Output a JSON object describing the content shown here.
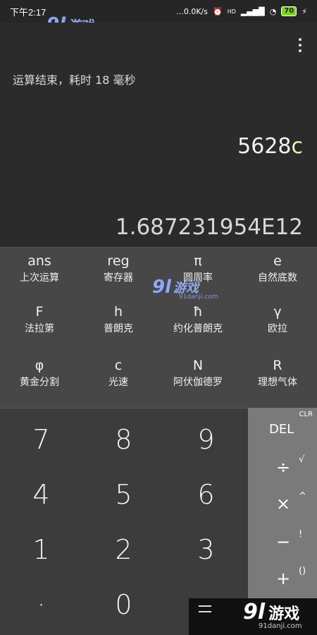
{
  "status_bar": {
    "time": "下午2:17",
    "net_speed": "...0.0K/s",
    "alarm": "⏰",
    "hd": "HD",
    "signal": "▂▄▆█",
    "wifi": "◔",
    "battery": "70",
    "charging": "⚡"
  },
  "watermark": {
    "logo": "9l",
    "text": "游戏",
    "sub": "91danji.com"
  },
  "display": {
    "status_message": "运算结束，耗时 18 毫秒",
    "expression_main": "5628",
    "expression_const": "c",
    "result": "1.687231954E12"
  },
  "constants": [
    {
      "symbol": "ans",
      "label": "上次运算"
    },
    {
      "symbol": "reg",
      "label": "寄存器"
    },
    {
      "symbol": "π",
      "label": "圆周率"
    },
    {
      "symbol": "e",
      "label": "自然底数"
    },
    {
      "symbol": "F",
      "label": "法拉第"
    },
    {
      "symbol": "h",
      "label": "普朗克"
    },
    {
      "symbol": "ħ",
      "label": "约化普朗克"
    },
    {
      "symbol": "γ",
      "label": "欧拉"
    },
    {
      "symbol": "φ",
      "label": "黄金分割"
    },
    {
      "symbol": "c",
      "label": "光速"
    },
    {
      "symbol": "N",
      "label": "阿伏伽德罗"
    },
    {
      "symbol": "R",
      "label": "理想气体"
    }
  ],
  "keys": [
    "7",
    "8",
    "9",
    "4",
    "5",
    "6",
    "1",
    "2",
    "3",
    "·",
    "0"
  ],
  "operators": {
    "clr": "CLR",
    "del": "DEL",
    "divide": "÷",
    "sqrt": "√",
    "multiply": "×",
    "power": "^",
    "minus": "−",
    "factorial": "!",
    "plus": "+",
    "parens": "()"
  }
}
